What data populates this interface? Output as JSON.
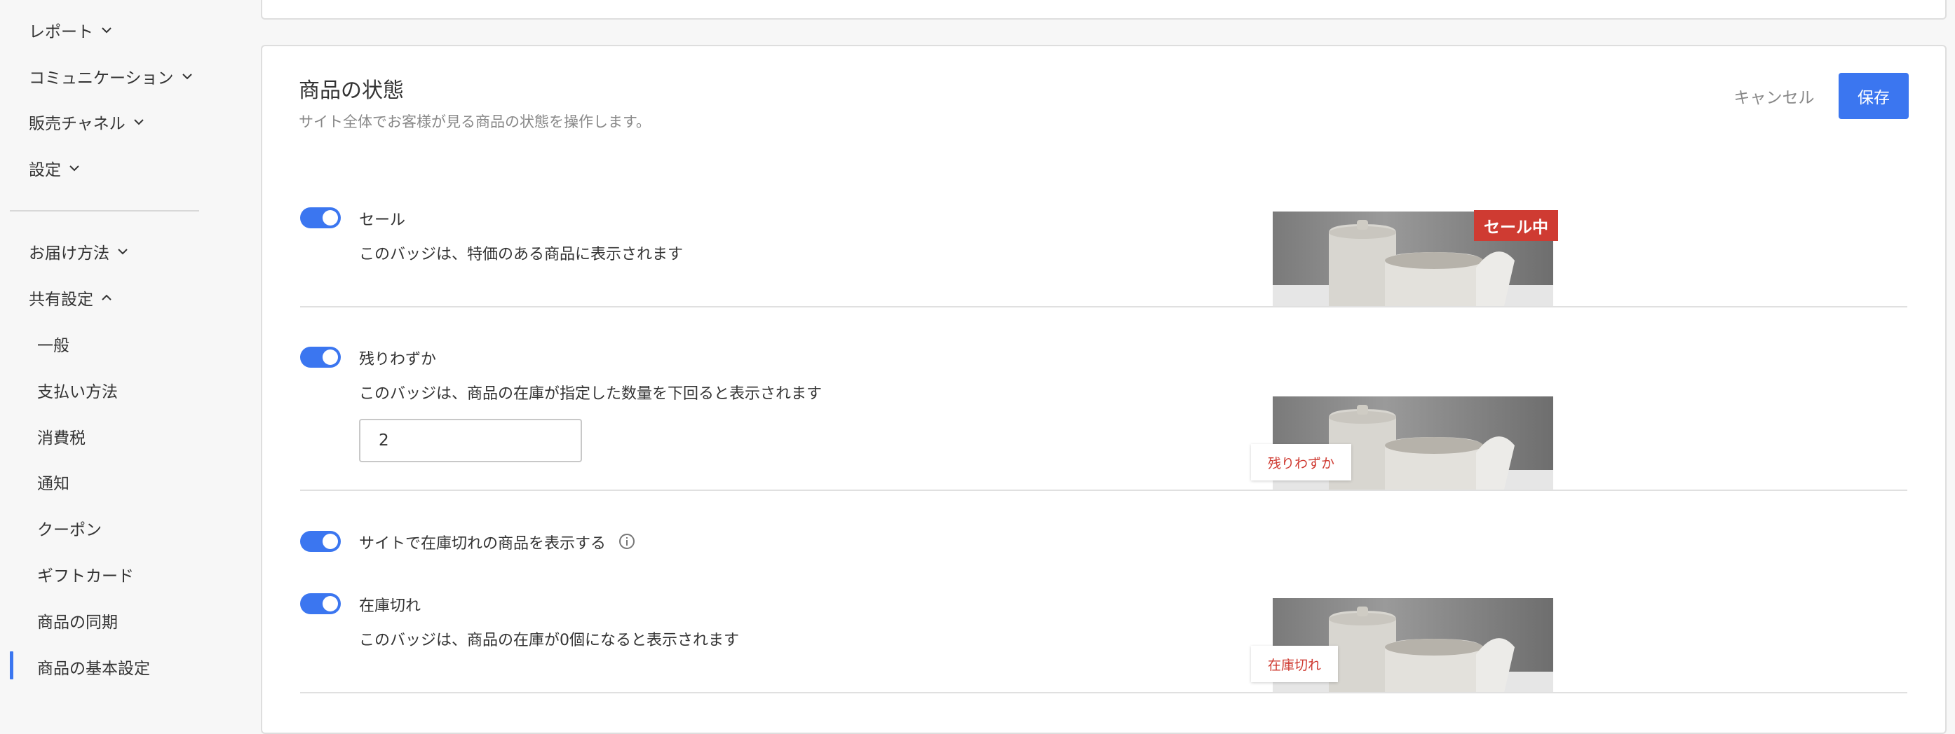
{
  "sidebar": {
    "items": [
      {
        "label": "レポート"
      },
      {
        "label": "コミュニケーション"
      },
      {
        "label": "販売チャネル"
      },
      {
        "label": "設定"
      },
      {
        "label": "お届け方法"
      },
      {
        "label": "共有設定"
      }
    ],
    "sub_items": [
      {
        "label": "一般"
      },
      {
        "label": "支払い方法"
      },
      {
        "label": "消費税"
      },
      {
        "label": "通知"
      },
      {
        "label": "クーポン"
      },
      {
        "label": "ギフトカード"
      },
      {
        "label": "商品の同期"
      },
      {
        "label": "商品の基本設定"
      }
    ],
    "active_item": "商品の基本設定"
  },
  "panel": {
    "title": "商品の状態",
    "subtitle": "サイト全体でお客様が見る商品の状態を操作します。",
    "cancel_label": "キャンセル",
    "save_label": "保存"
  },
  "settings": [
    {
      "label": "セール",
      "description": "このバッジは、特価のある商品に表示されます",
      "enabled": true,
      "badge": "セール中"
    },
    {
      "label": "残りわずか",
      "description": "このバッジは、商品の在庫が指定した数量を下回ると表示されます",
      "enabled": true,
      "badge": "残りわずか",
      "quantity": "2"
    },
    {
      "label": "サイトで在庫切れの商品を表示する",
      "enabled": true
    },
    {
      "label": "在庫切れ",
      "description": "このバッジは、商品の在庫が0個になると表示されます",
      "enabled": true,
      "badge": "在庫切れ"
    }
  ],
  "colors": {
    "accent": "#3b76f0",
    "badge_red": "#cf3b32"
  }
}
